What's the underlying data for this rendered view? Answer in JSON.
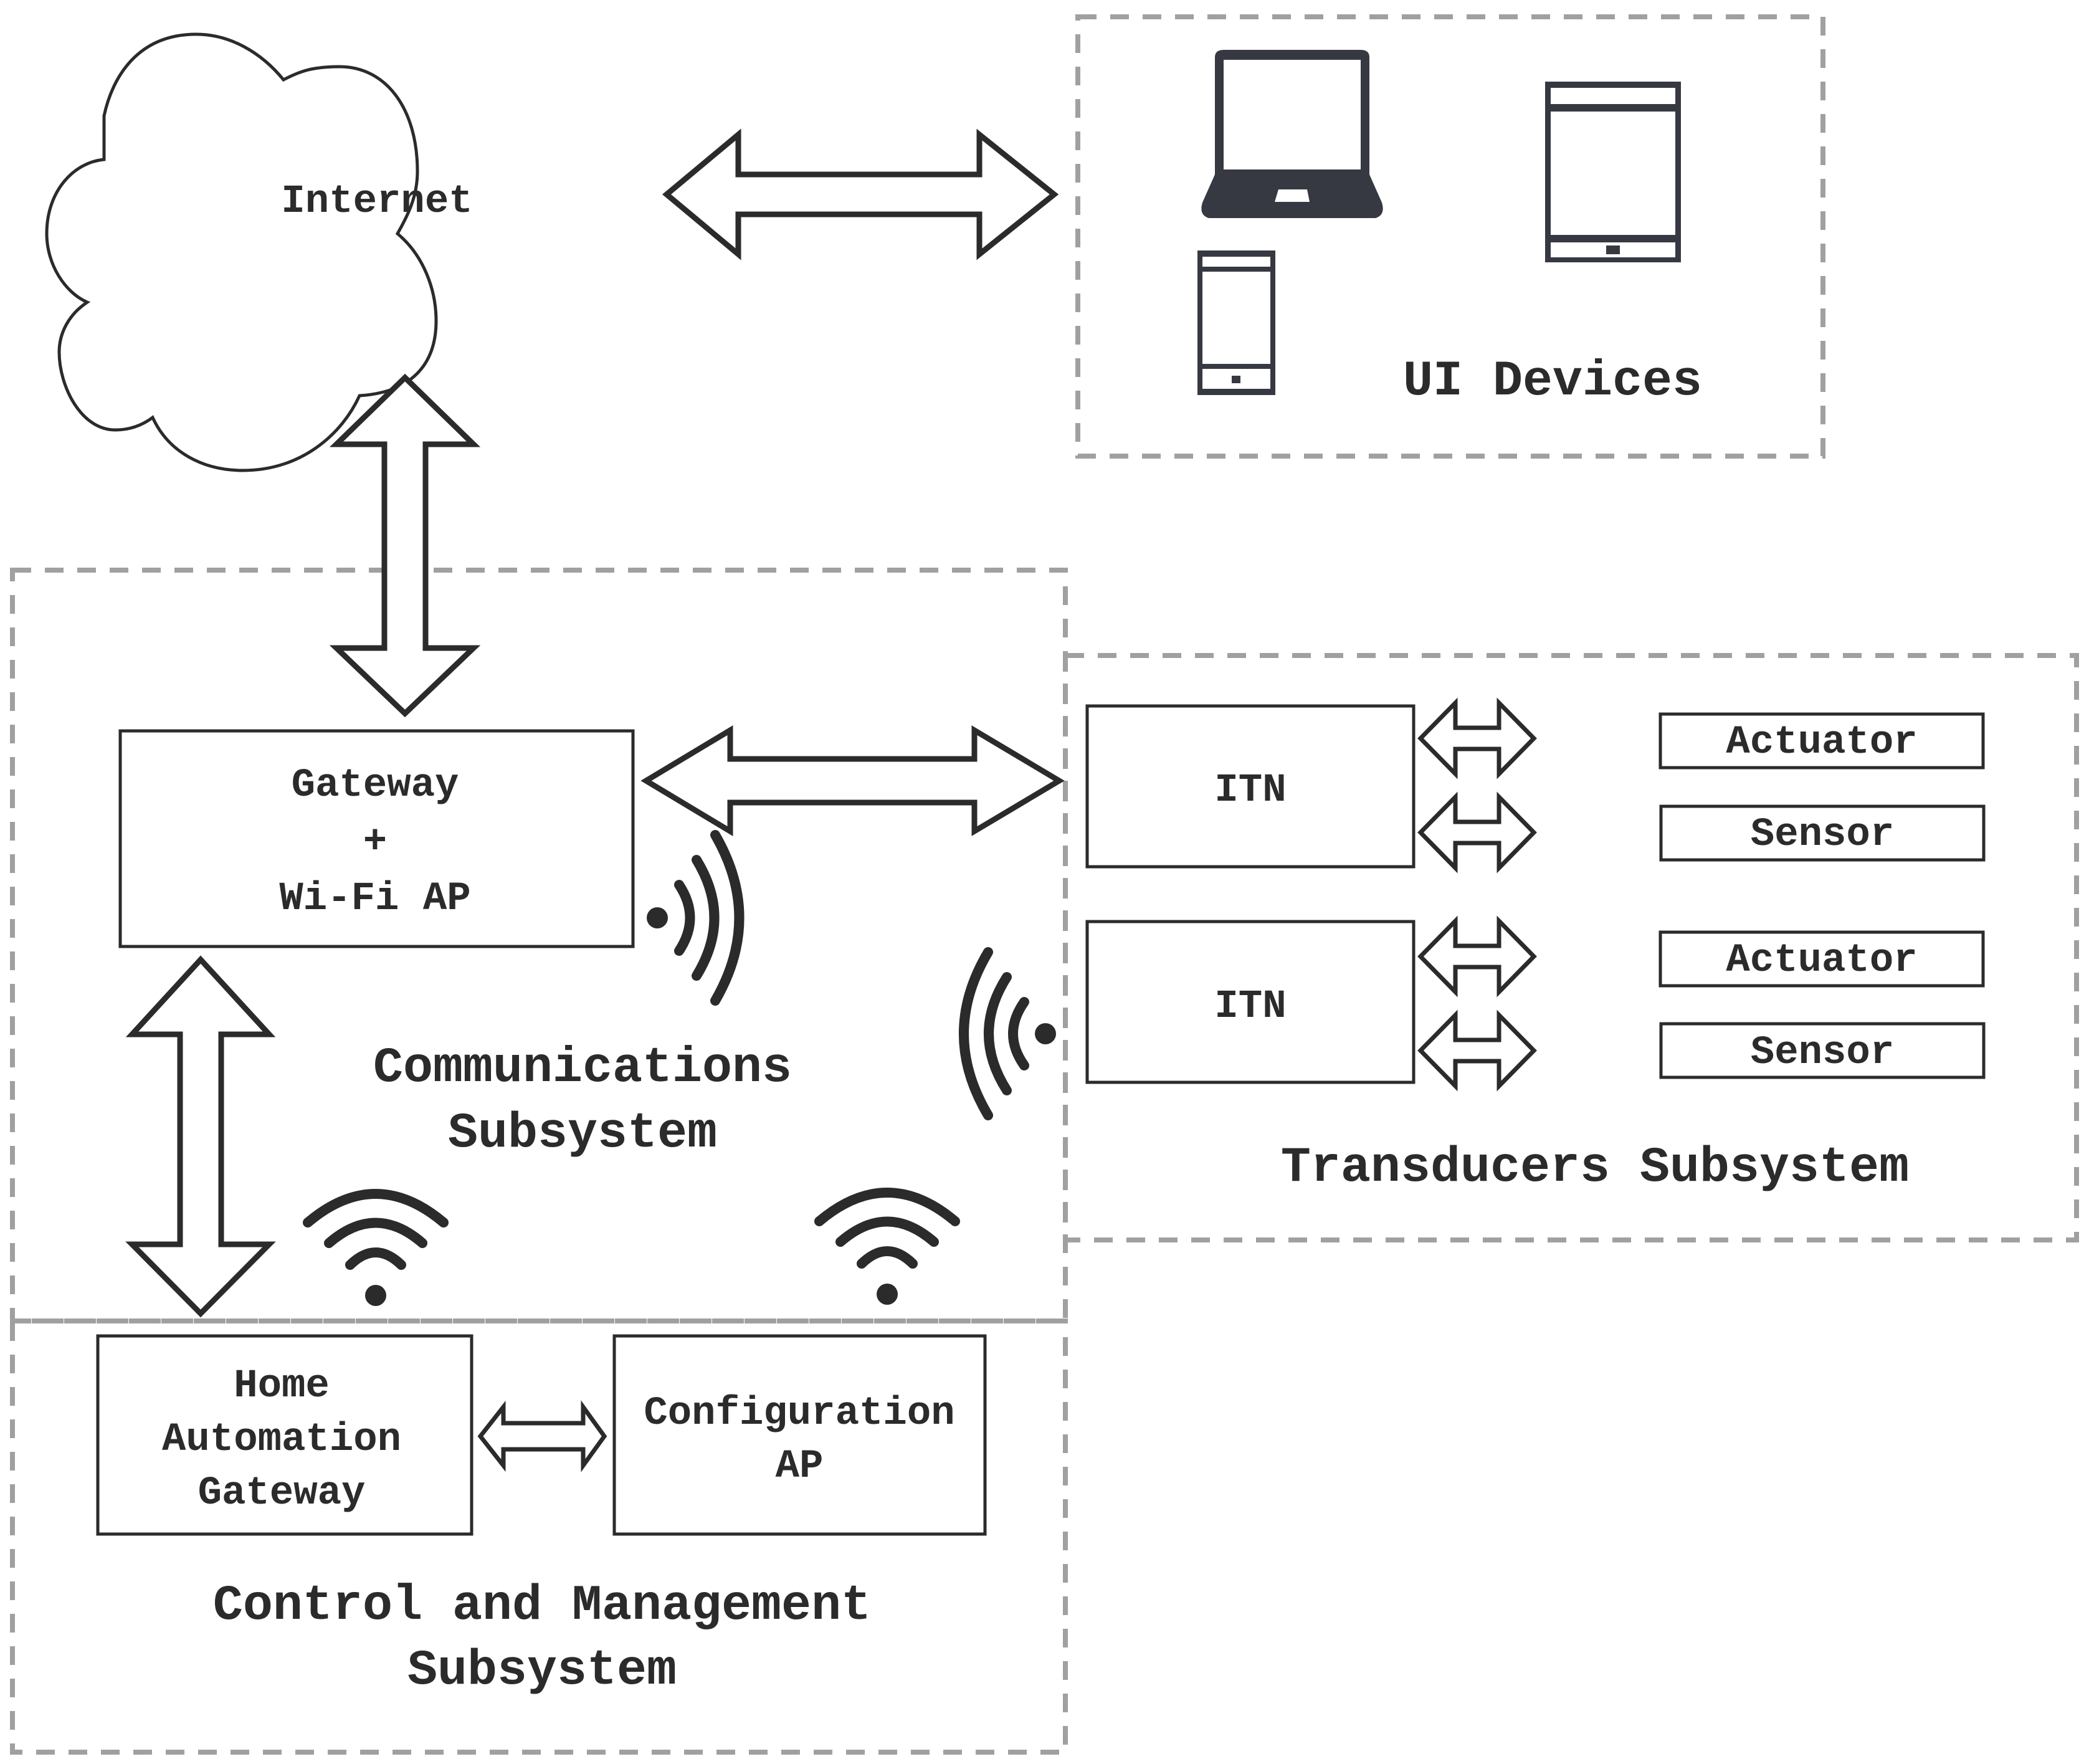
{
  "diagram": {
    "internet": {
      "label": "Internet",
      "icon": "cloud-icon"
    },
    "ui_devices": {
      "title": "UI Devices",
      "icons": [
        "laptop-icon",
        "tablet-icon",
        "smartphone-icon"
      ]
    },
    "communications": {
      "title_line1": "Communications",
      "title_line2": "Subsystem",
      "gateway": {
        "line1": "Gateway",
        "line2": "+",
        "line3": "Wi-Fi AP"
      }
    },
    "transducers": {
      "title": "Transducers Subsystem",
      "itn_units": [
        {
          "label": "ITN",
          "actuator": "Actuator",
          "sensor": "Sensor"
        },
        {
          "label": "ITN",
          "actuator": "Actuator",
          "sensor": "Sensor"
        }
      ]
    },
    "control": {
      "title_line1": "Control and Management",
      "title_line2": "Subsystem",
      "home_gateway": {
        "line1": "Home",
        "line2": "Automation",
        "line3": "Gateway"
      },
      "config_ap": {
        "line1": "Configuration",
        "line2": "AP"
      }
    },
    "colors": {
      "stroke": "#2b2b2b",
      "dashed_border": "#a0a0a0",
      "device_icon": "#363941"
    }
  }
}
